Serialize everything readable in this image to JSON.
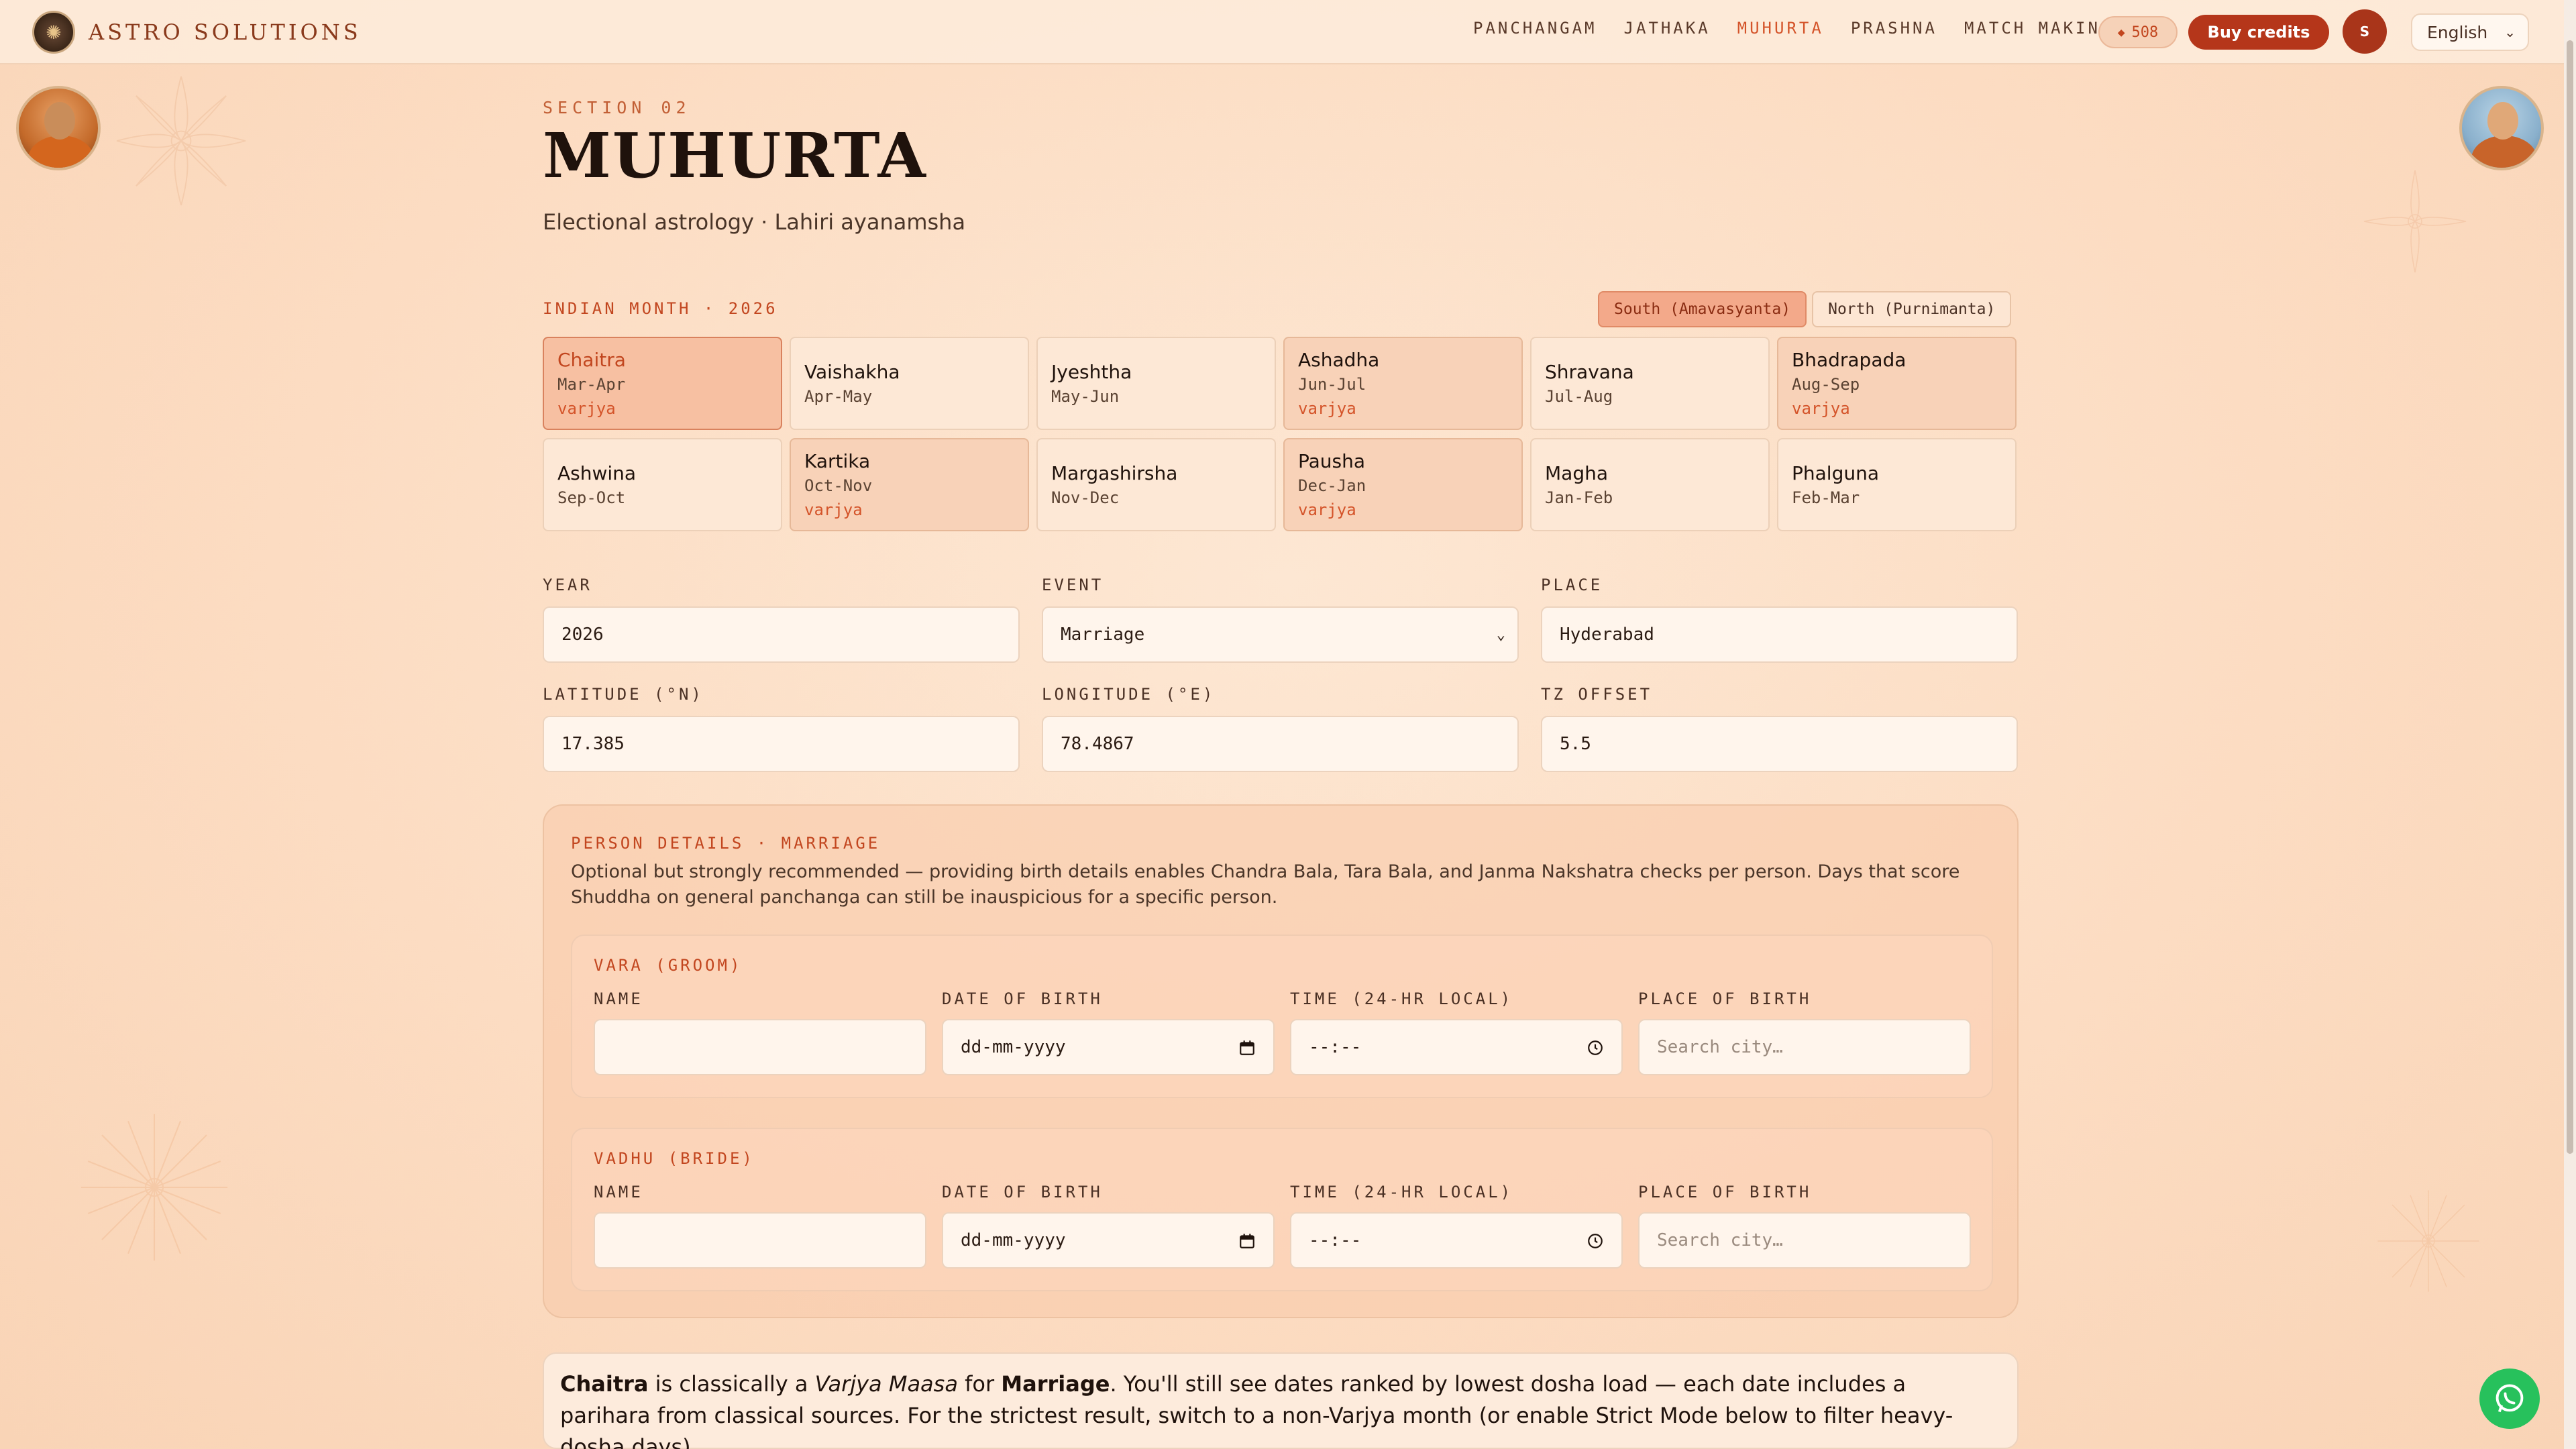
{
  "brand": {
    "name": "ASTRO SOLUTIONS",
    "logo_icon": "sun-logo-icon"
  },
  "nav": {
    "items": [
      {
        "label": "PANCHANGAM",
        "active": false
      },
      {
        "label": "JATHAKA",
        "active": false
      },
      {
        "label": "MUHURTA",
        "active": true
      },
      {
        "label": "PRASHNA",
        "active": false
      },
      {
        "label": "MATCH MAKING",
        "active": false
      }
    ]
  },
  "credits": {
    "value": "508",
    "icon": "diamond-icon"
  },
  "buy_label": "Buy credits",
  "user": {
    "initial": "S"
  },
  "language": {
    "selected": "English"
  },
  "page": {
    "eyebrow": "SECTION 02",
    "title": "MUHURTA",
    "subtitle": "Electional astrology · Lahiri ayanamsha"
  },
  "month_section": {
    "header": "INDIAN MONTH · 2026",
    "toggles": [
      {
        "label": "South (Amavasyanta)",
        "active": true
      },
      {
        "label": "North (Purnimanta)",
        "active": false
      }
    ],
    "months": [
      {
        "name": "Chaitra",
        "range": "Mar-Apr",
        "tag": "varjya"
      },
      {
        "name": "Vaishakha",
        "range": "Apr-May",
        "tag": ""
      },
      {
        "name": "Jyeshtha",
        "range": "May-Jun",
        "tag": ""
      },
      {
        "name": "Ashadha",
        "range": "Jun-Jul",
        "tag": "varjya"
      },
      {
        "name": "Shravana",
        "range": "Jul-Aug",
        "tag": ""
      },
      {
        "name": "Bhadrapada",
        "range": "Aug-Sep",
        "tag": "varjya"
      },
      {
        "name": "Ashwina",
        "range": "Sep-Oct",
        "tag": ""
      },
      {
        "name": "Kartika",
        "range": "Oct-Nov",
        "tag": "varjya"
      },
      {
        "name": "Margashirsha",
        "range": "Nov-Dec",
        "tag": ""
      },
      {
        "name": "Pausha",
        "range": "Dec-Jan",
        "tag": "varjya"
      },
      {
        "name": "Magha",
        "range": "Jan-Feb",
        "tag": ""
      },
      {
        "name": "Phalguna",
        "range": "Feb-Mar",
        "tag": ""
      }
    ]
  },
  "form": {
    "year": {
      "label": "YEAR",
      "value": "2026"
    },
    "event": {
      "label": "EVENT",
      "value": "Marriage"
    },
    "place": {
      "label": "PLACE",
      "value": "Hyderabad"
    },
    "latitude": {
      "label": "LATITUDE (°N)",
      "value": "17.385"
    },
    "longitude": {
      "label": "LONGITUDE (°E)",
      "value": "78.4867"
    },
    "tz": {
      "label": "TZ OFFSET",
      "value": "5.5"
    }
  },
  "person_details": {
    "title": "PERSON DETAILS · MARRIAGE",
    "description": "Optional but strongly recommended — providing birth details enables Chandra Bala, Tara Bala, and Janma Nakshatra checks per person. Days that score Shuddha on general panchanga can still be inauspicious for a specific person.",
    "groom": {
      "title": "VARA (GROOM)",
      "name_label": "NAME",
      "name_value": "",
      "dob_label": "DATE OF BIRTH",
      "dob_placeholder": "dd-mm-yyyy",
      "time_label": "TIME (24-HR LOCAL)",
      "time_placeholder": "--:--",
      "pob_label": "PLACE OF BIRTH",
      "pob_placeholder": "Search city…"
    },
    "bride": {
      "title": "VADHU (BRIDE)",
      "name_label": "NAME",
      "name_value": "",
      "dob_label": "DATE OF BIRTH",
      "dob_placeholder": "dd-mm-yyyy",
      "time_label": "TIME (24-HR LOCAL)",
      "time_placeholder": "--:--",
      "pob_label": "PLACE OF BIRTH",
      "pob_placeholder": "Search city…"
    }
  },
  "note": {
    "month": "Chaitra",
    "text1": " is classically a ",
    "term": "Varjya Maasa",
    "text2": " for ",
    "event": "Marriage",
    "text3": ". You'll still see dates ranked by lowest dosha load — each date includes a parihara from classical sources. For the strictest result, switch to a non-Varjya month (or enable Strict Mode below to filter heavy-dosha days)."
  },
  "colors": {
    "accent": "#c2461f",
    "primary_button": "#b5361a",
    "whatsapp": "#27c15c"
  }
}
